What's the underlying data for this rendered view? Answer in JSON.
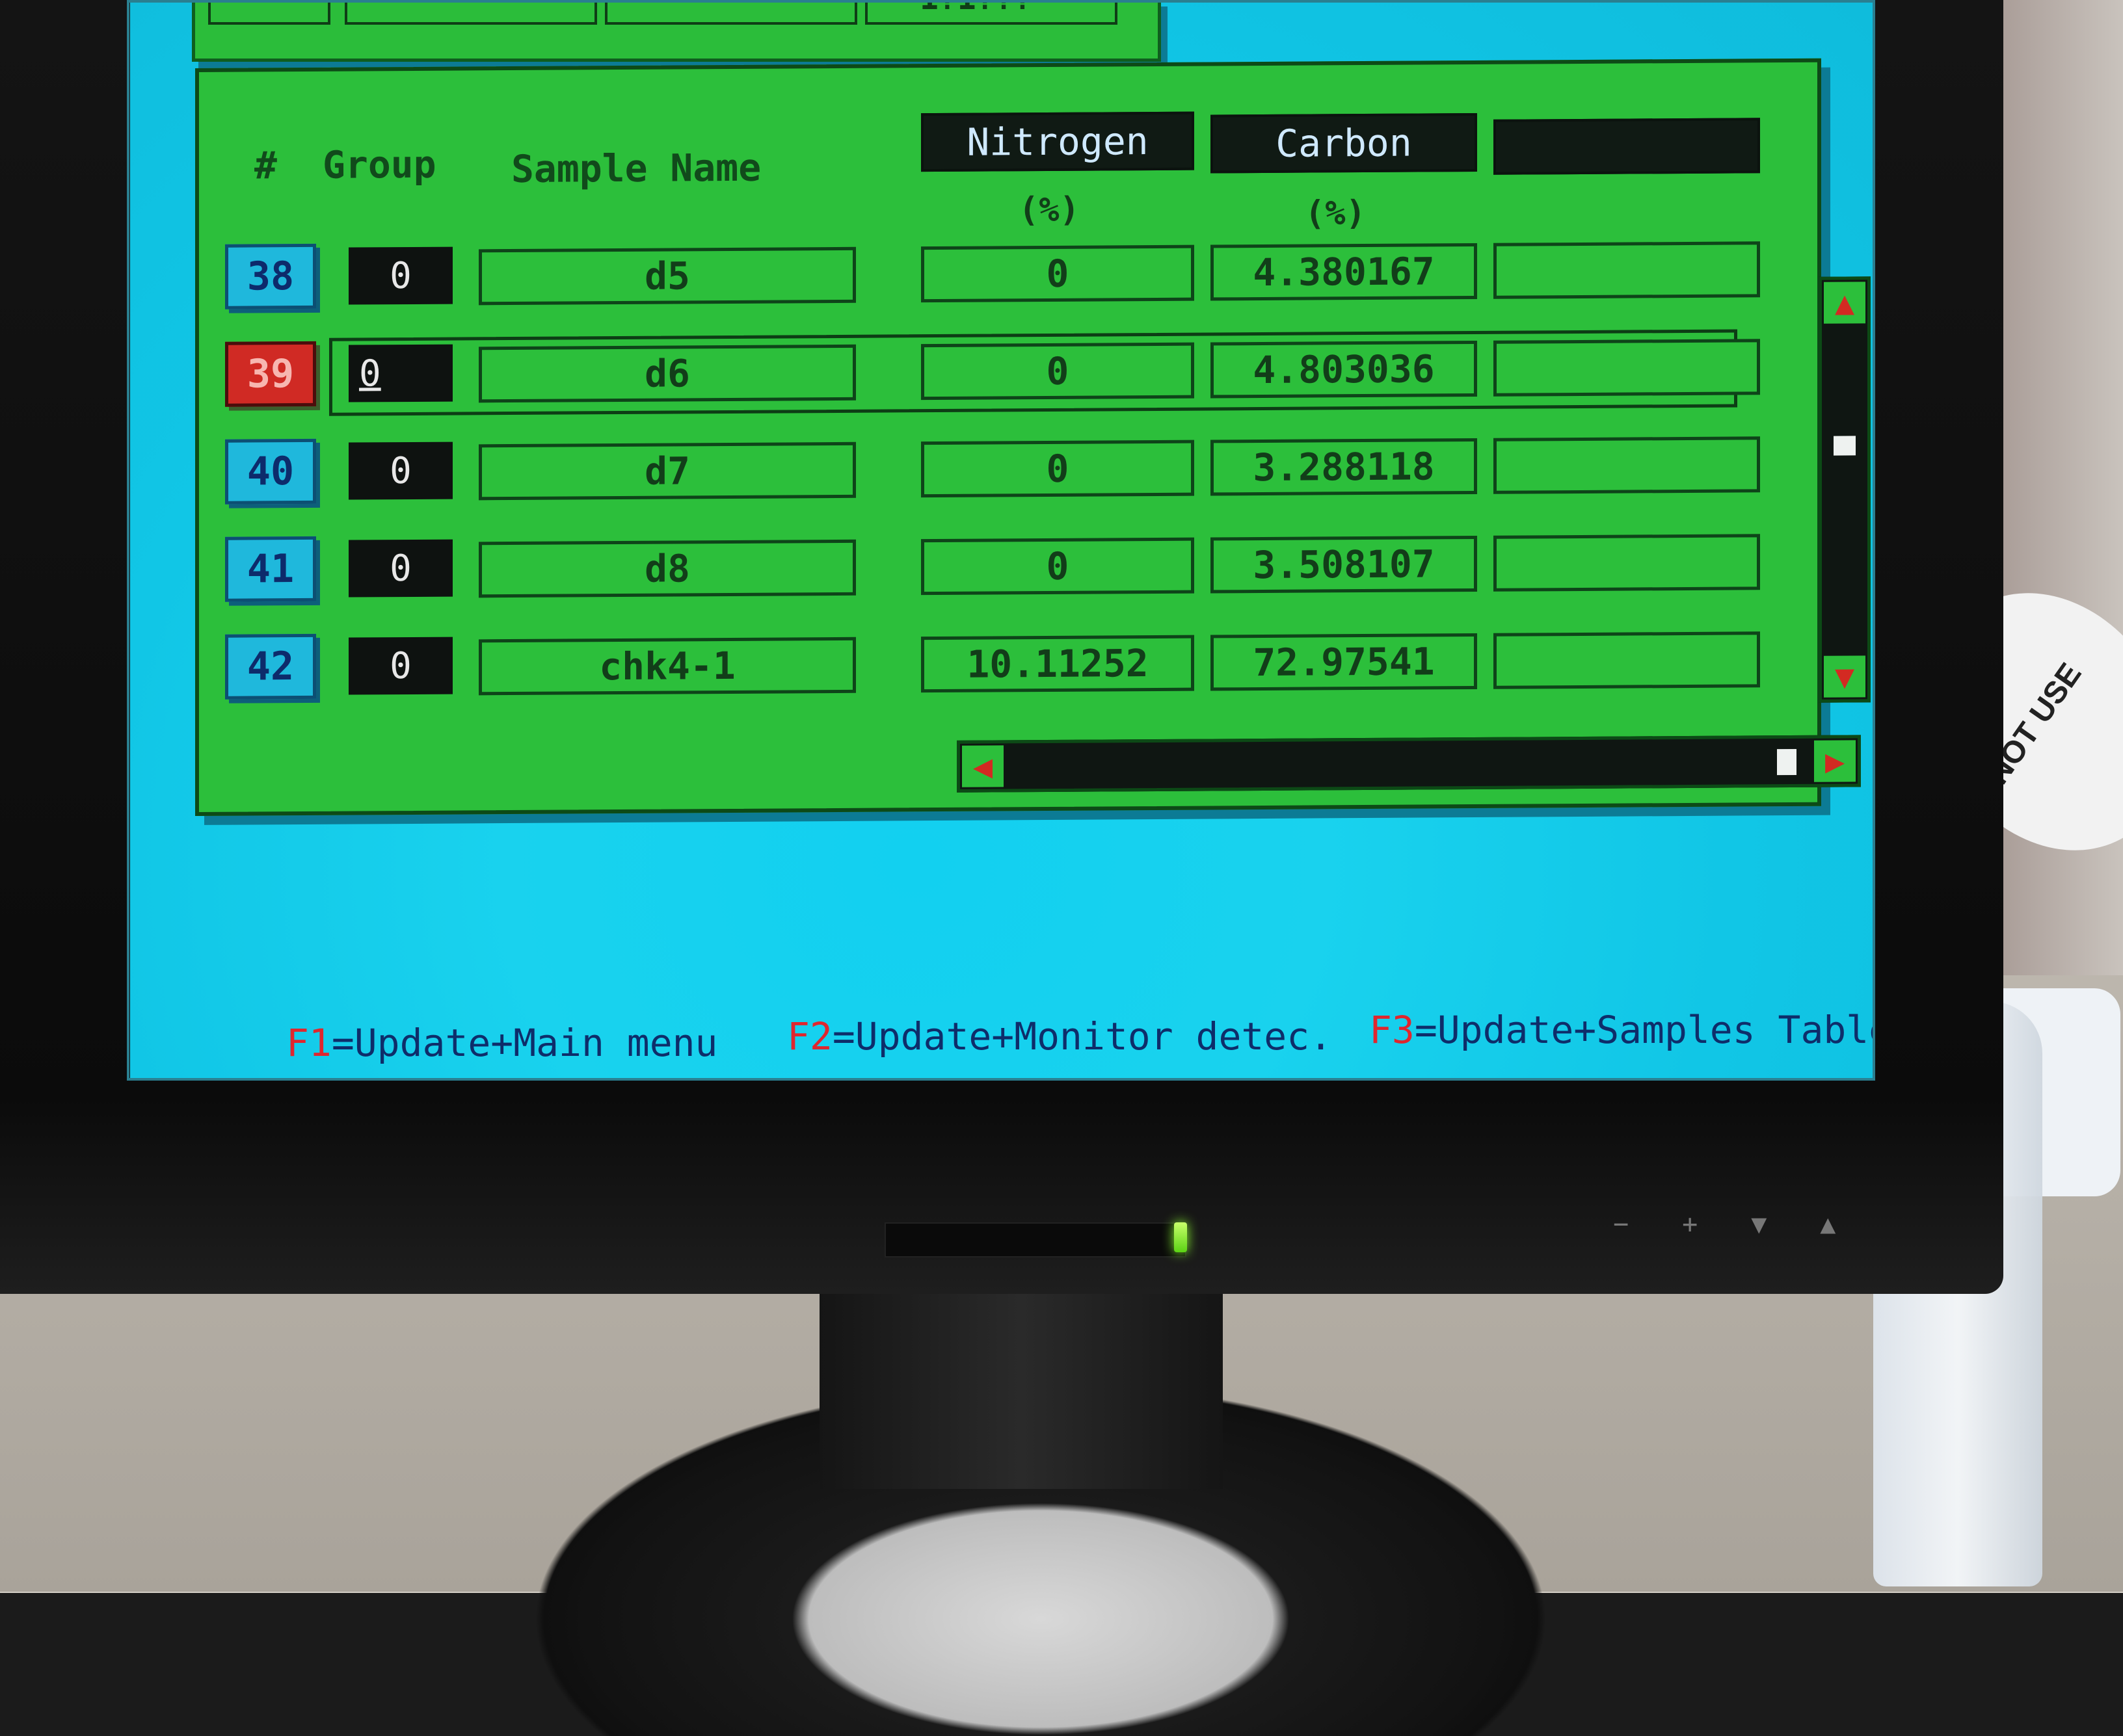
{
  "top_panel": {
    "partial_value": "1?1???"
  },
  "table": {
    "headers": {
      "num": "#",
      "group": "Group",
      "sample_name": "Sample Name"
    },
    "columns": [
      {
        "label": "Nitrogen",
        "unit": "(%)"
      },
      {
        "label": "Carbon",
        "unit": "(%)"
      },
      {
        "label": "",
        "unit": ""
      }
    ],
    "rows": [
      {
        "num": "38",
        "group": "0",
        "name": "d5",
        "nitrogen": "0",
        "carbon": "4.380167",
        "extra": ""
      },
      {
        "num": "39",
        "group": "0",
        "name": "d6",
        "nitrogen": "0",
        "carbon": "4.803036",
        "extra": ""
      },
      {
        "num": "40",
        "group": "0",
        "name": "d7",
        "nitrogen": "0",
        "carbon": "3.288118",
        "extra": ""
      },
      {
        "num": "41",
        "group": "0",
        "name": "d8",
        "nitrogen": "0",
        "carbon": "3.508107",
        "extra": ""
      },
      {
        "num": "42",
        "group": "0",
        "name": "chk4-1",
        "nitrogen": "10.11252",
        "carbon": "72.97541",
        "extra": ""
      }
    ],
    "selected_row": "39"
  },
  "scroll": {
    "up": "▲",
    "down": "▼",
    "left": "◀",
    "right": "▶",
    "vertical_position": 0.35,
    "horizontal_position": 0.98
  },
  "function_keys": [
    {
      "key": "F1",
      "text": "=Update+Main menu"
    },
    {
      "key": "F2",
      "text": "=Update+Monitor detec."
    },
    {
      "key": "F3",
      "text": "=Update+Samples Table"
    }
  ],
  "monitor": {
    "buttons": [
      "−",
      "+",
      "▼",
      "▲"
    ],
    "sticker_text": "NOT USE"
  },
  "colors": {
    "screen_bg": "#12d0f0",
    "panel_bg": "#2cbf3b",
    "active_row": "#d02a24",
    "row_num_bg": "#1fb8dc",
    "fkey_accent": "#e0262e"
  }
}
